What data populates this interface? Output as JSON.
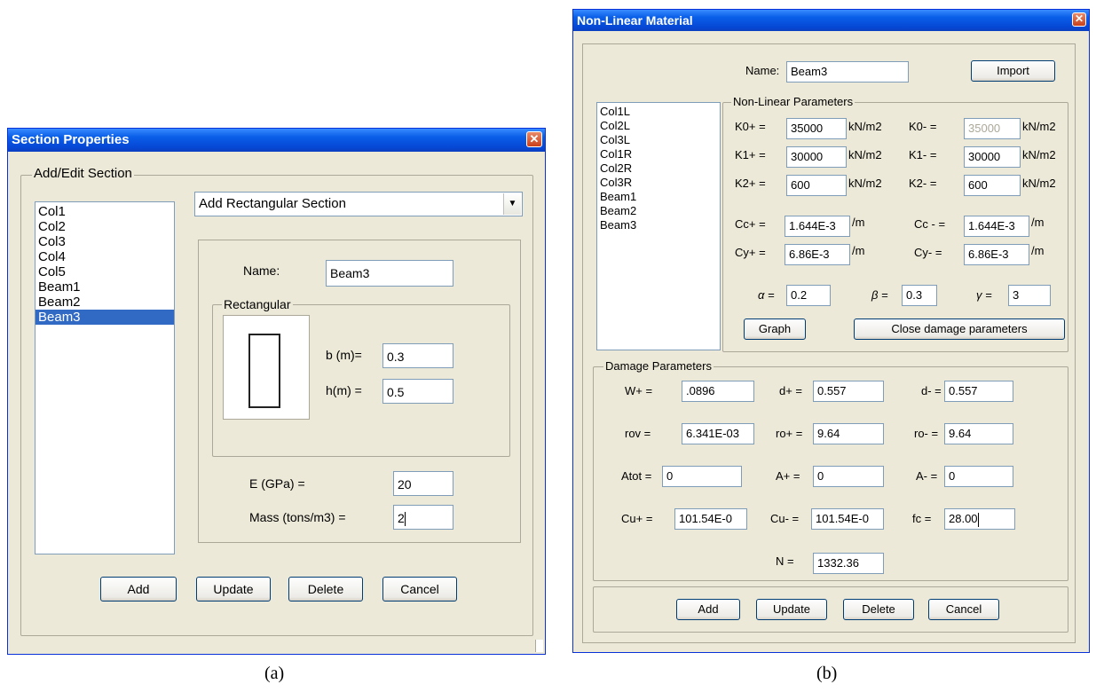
{
  "section": {
    "title": "Section Properties",
    "close": "✕",
    "group_label": "Add/Edit Section",
    "list": [
      "Col1",
      "Col2",
      "Col3",
      "Col4",
      "Col5",
      "Beam1",
      "Beam2",
      "Beam3"
    ],
    "selected": "Beam3",
    "section_type": "Add Rectangular Section",
    "name_label": "Name:",
    "name_value": "Beam3",
    "rect_label": "Rectangular",
    "b_label": "b (m)=",
    "b_value": "0.3",
    "h_label": "h(m) =",
    "h_value": "0.5",
    "e_label": "E (GPa) =",
    "e_value": "20",
    "mass_label": "Mass (tons/m3) =",
    "mass_value": "2",
    "buttons": {
      "add": "Add",
      "update": "Update",
      "delete": "Delete",
      "cancel": "Cancel"
    }
  },
  "nonlinear": {
    "title": "Non-Linear Material",
    "close": "✕",
    "name_label": "Name:",
    "name_value": "Beam3",
    "import": "Import",
    "list": [
      "Col1L",
      "Col2L",
      "Col3L",
      "Col1R",
      "Col2R",
      "Col3R",
      "Beam1",
      "Beam2",
      "Beam3"
    ],
    "params_label": "Non-Linear Parameters",
    "k0p_label": "K0+ =",
    "k0p_value": "35000",
    "k0p_unit": "kN/m2",
    "k0m_label": "K0- =",
    "k0m_value": "35000",
    "k0m_unit": "kN/m2",
    "k1p_label": "K1+ =",
    "k1p_value": "30000",
    "k1p_unit": "kN/m2",
    "k1m_label": "K1- =",
    "k1m_value": "30000",
    "k1m_unit": "kN/m2",
    "k2p_label": "K2+ =",
    "k2p_value": "600",
    "k2p_unit": "kN/m2",
    "k2m_label": "K2- =",
    "k2m_value": "600",
    "k2m_unit": "kN/m2",
    "ccp_label": "Cc+ =",
    "ccp_value": "1.644E-3",
    "ccp_unit": "/m",
    "ccm_label": "Cc - =",
    "ccm_value": "1.644E-3",
    "ccm_unit": "/m",
    "cyp_label": "Cy+ =",
    "cyp_value": "6.86E-3",
    "cyp_unit": "/m",
    "cym_label": "Cy- =",
    "cym_value": "6.86E-3",
    "cym_unit": "/m",
    "alpha_label": "α =",
    "alpha_value": "0.2",
    "beta_label": "β =",
    "beta_value": "0.3",
    "gamma_label": "γ =",
    "gamma_value": "3",
    "graph": "Graph",
    "close_damage": "Close damage parameters",
    "damage_label": "Damage Parameters",
    "wp_label": "W+ =",
    "wp_value": ".0896",
    "dp_label": "d+ =",
    "dp_value": "0.557",
    "dm_label": "d- =",
    "dm_value": "0.557",
    "rov_label": "rov =",
    "rov_value": "6.341E-03",
    "rop_label": "ro+ =",
    "rop_value": "9.64",
    "rom_label": "ro- =",
    "rom_value": "9.64",
    "atot_label": "Atot =",
    "atot_value": "0",
    "ap_label": "A+ =",
    "ap_value": "0",
    "am_label": "A- =",
    "am_value": "0",
    "cup_label": "Cu+ =",
    "cup_value": "101.54E-0",
    "cum_label": "Cu- =",
    "cum_value": "101.54E-0",
    "fc_label": "fc =",
    "fc_value": "28.00",
    "n_label": "N =",
    "n_value": "1332.36",
    "buttons": {
      "add": "Add",
      "update": "Update",
      "delete": "Delete",
      "cancel": "Cancel"
    }
  },
  "captions": {
    "a": "(a)",
    "b": "(b)"
  }
}
